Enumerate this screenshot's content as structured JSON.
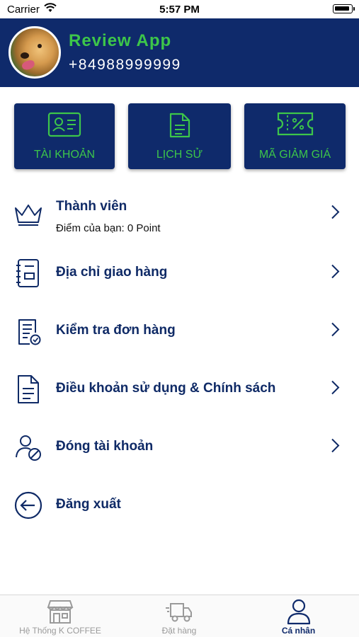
{
  "status_bar": {
    "carrier": "Carrier",
    "time": "5:57 PM"
  },
  "profile": {
    "name": "Review App",
    "phone": "+84988999999"
  },
  "quick_actions": [
    {
      "label": "TÀI KHOẢN",
      "icon": "id-card-icon"
    },
    {
      "label": "LỊCH SỬ",
      "icon": "document-icon"
    },
    {
      "label": "MÃ GIẢM GIÁ",
      "icon": "coupon-icon"
    }
  ],
  "menu": {
    "membership": {
      "label": "Thành viên",
      "sub": "Điểm của bạn: 0 Point",
      "icon": "crown-icon"
    },
    "address": {
      "label": "Địa chỉ giao hàng",
      "icon": "address-book-icon"
    },
    "orders": {
      "label": "Kiểm tra đơn hàng",
      "icon": "order-check-icon"
    },
    "terms": {
      "label": "Điều khoản sử dụng & Chính sách",
      "icon": "document-icon"
    },
    "close_account": {
      "label": "Đóng tài khoản",
      "icon": "user-block-icon"
    },
    "logout": {
      "label": "Đăng xuất",
      "icon": "logout-arrow-icon"
    }
  },
  "tabbar": {
    "tabs": [
      {
        "label": "Hệ Thống K COFFEE",
        "icon": "store-icon",
        "active": false
      },
      {
        "label": "Đặt hàng",
        "icon": "delivery-truck-icon",
        "active": false
      },
      {
        "label": "Cá nhân",
        "icon": "user-icon",
        "active": true
      }
    ]
  },
  "colors": {
    "primary": "#0f2a6b",
    "accent": "#3dc64a",
    "text_dark": "#0f2a66",
    "tab_inactive": "#9a9a9a"
  }
}
